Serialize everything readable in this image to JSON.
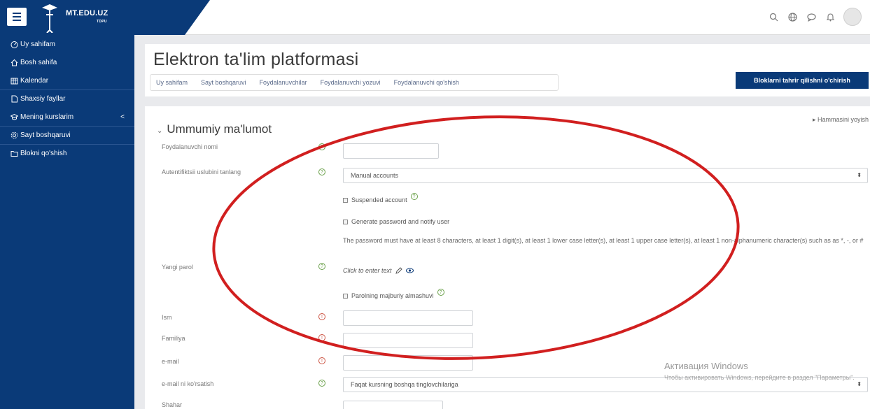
{
  "navbar": {
    "site_name": "MT.EDU.UZ",
    "site_sub": "TDPU"
  },
  "sidebar": {
    "items": [
      {
        "label": "Uy sahifam"
      },
      {
        "label": "Bosh sahifa"
      },
      {
        "label": "Kalendar"
      },
      {
        "label": "Shaxsiy fayllar"
      },
      {
        "label": "Mening kurslarim"
      },
      {
        "label": "Sayt boshqaruvi"
      },
      {
        "label": "Blokni qo'shish"
      }
    ],
    "chevron": "<"
  },
  "header": {
    "title": "Elektron ta'lim platformasi",
    "breadcrumb": [
      "Uy sahifam",
      "Sayt boshqaruvi",
      "Foydalanuvchilar",
      "Foydalanuvchi yozuvi",
      "Foydalanuvchi qo'shish"
    ],
    "edit_blocks_label": "Bloklarni tahrir qilishni o'chirish"
  },
  "form": {
    "expand_all": "▸ Hammasini yoyish",
    "section_title": "Ummumiy ma'lumot",
    "fields": {
      "username_label": "Foydalanuvchi nomi",
      "auth_label": "Autentifiktsii uslubini tanlang",
      "auth_value": "Manual accounts",
      "suspended_label": "Suspended account",
      "generate_label": "Generate password and notify user",
      "password_note": "The password must have at least 8 characters, at least 1 digit(s), at least 1 lower case letter(s), at least 1 upper case letter(s), at least 1 non-alphanumeric character(s) such as as *, -, or #",
      "new_password_label": "Yangi parol",
      "click_to_enter": "Click to enter text",
      "force_change_label": "Parolning majburiy almashuvi",
      "firstname_label": "Ism",
      "lastname_label": "Familiya",
      "email_label": "e-mail",
      "email_display_label": "e-mail ni ko'rsatish",
      "email_display_value": "Faqat kursning boshqa tinglovchilariga",
      "city_label": "Shahar"
    }
  },
  "windows_activation": {
    "title": "Активация Windows",
    "subtitle": "Чтобы активировать Windows, перейдите в раздел \"Параметры\"."
  },
  "colors": {
    "brand": "#0a3a78",
    "annotation": "#d11f1f"
  }
}
